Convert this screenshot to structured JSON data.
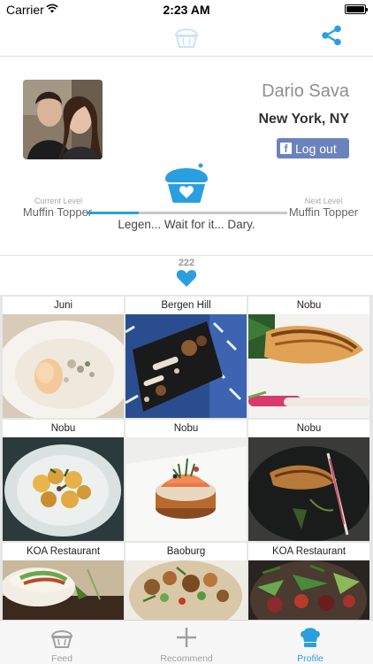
{
  "status_bar": {
    "carrier": "Carrier",
    "time": "2:23 AM"
  },
  "colors": {
    "accent": "#2a9fe0",
    "facebook": "#6b83bd",
    "inactive": "#a0a0a0"
  },
  "nav": {
    "logo_icon": "muffin-logo-icon",
    "share_icon": "share-icon"
  },
  "profile": {
    "name": "Dario Sava",
    "city": "New York, NY",
    "logout_label": "Log out",
    "facebook_icon": "facebook-icon"
  },
  "level": {
    "current_caption": "Current Level",
    "current_name": "Muffin Topper",
    "next_caption": "Next Level",
    "next_name": "Muffin Topper",
    "progress": 0.26,
    "quote": "Legen... Wait for it... Dary."
  },
  "likes": {
    "count": "222"
  },
  "grid": {
    "tiles": [
      {
        "label": "Juni"
      },
      {
        "label": "Bergen Hill"
      },
      {
        "label": "Nobu"
      },
      {
        "label": "Nobu"
      },
      {
        "label": "Nobu"
      },
      {
        "label": "Nobu"
      },
      {
        "label": "KOA Restaurant"
      },
      {
        "label": "Baoburg"
      },
      {
        "label": "KOA Restaurant"
      }
    ]
  },
  "tab_bar": {
    "tabs": [
      {
        "label": "Feed",
        "icon": "muffin-icon",
        "active": false
      },
      {
        "label": "Recommend",
        "icon": "plus-icon",
        "active": false
      },
      {
        "label": "Profile",
        "icon": "chef-hat-icon",
        "active": true
      }
    ]
  }
}
